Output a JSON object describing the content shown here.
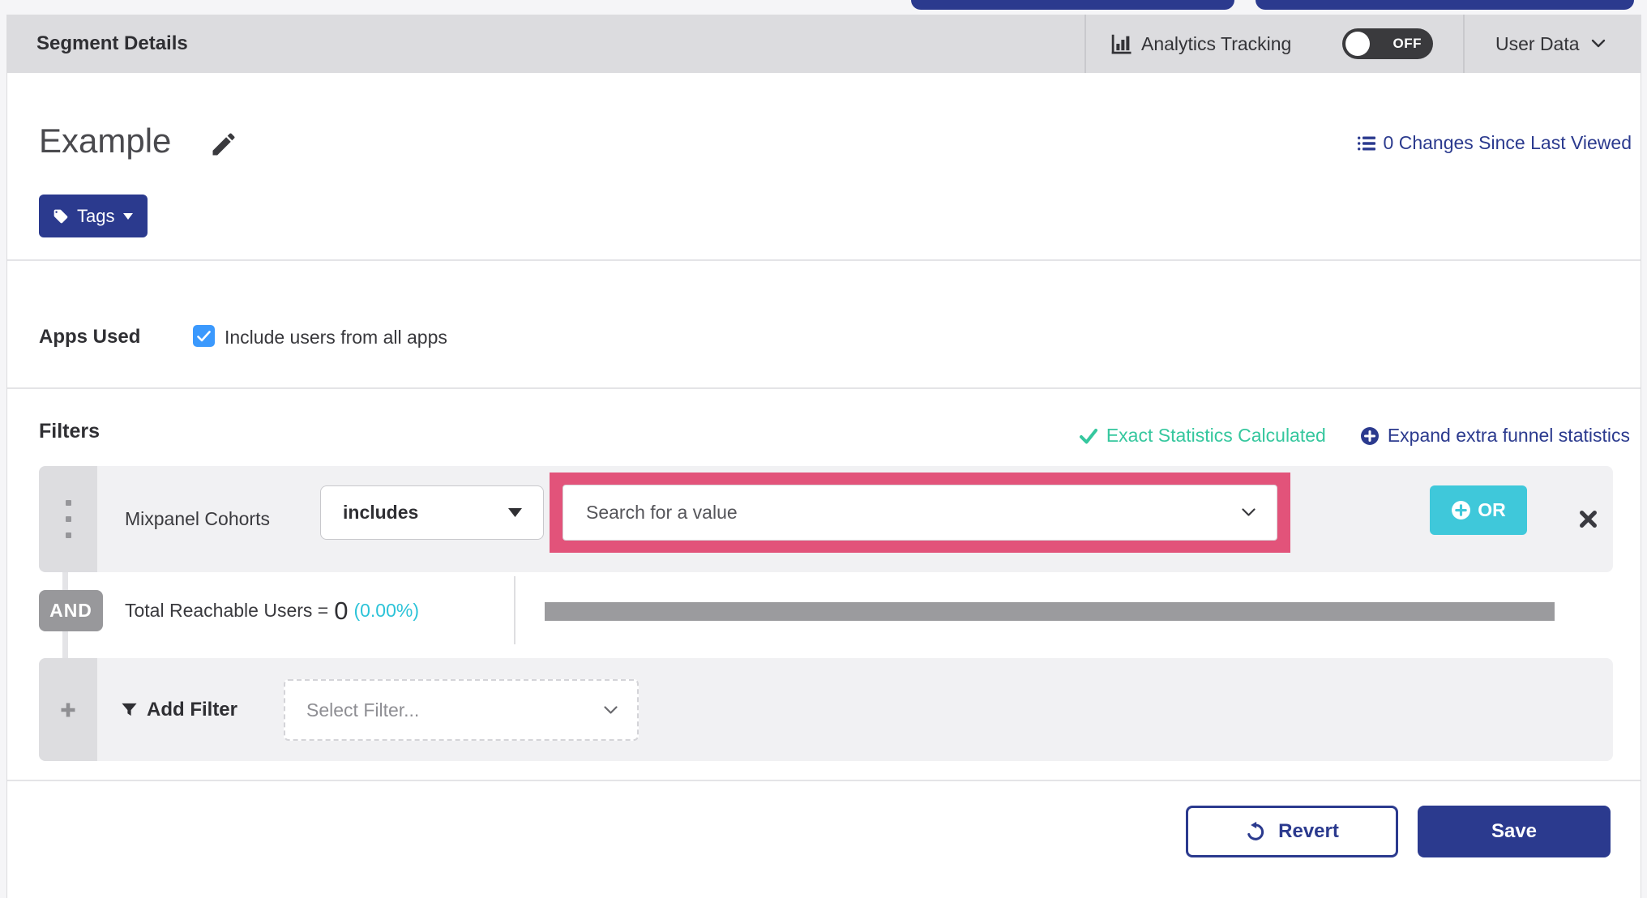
{
  "colors": {
    "indigo": "#2b3a8e",
    "cyan_button": "#3fc8da",
    "cyan_text": "#2cc3d8",
    "green_success": "#35c79e",
    "pink_highlight": "#e2537a",
    "header_bg": "#dcdcdf",
    "row_bg": "#f1f1f3",
    "checkbox_blue": "#3b99fd",
    "badge_gray": "#98989b",
    "bar_gray": "#9b9b9e",
    "toggle_bg": "#3a3a3d"
  },
  "header": {
    "title": "Segment Details",
    "analytics_label": "Analytics Tracking",
    "toggle_state": "OFF",
    "user_data_label": "User Data"
  },
  "segment": {
    "name": "Example",
    "tags_label": "Tags",
    "changes_link": "0 Changes Since Last Viewed"
  },
  "apps": {
    "label": "Apps Used",
    "checkbox_label": "Include users from all apps",
    "checked": true
  },
  "filters": {
    "heading": "Filters",
    "exact_stats": "Exact Statistics Calculated",
    "expand_stats": "Expand extra funnel statistics",
    "row": {
      "field": "Mixpanel Cohorts",
      "operator": "includes",
      "value_placeholder": "Search for a value",
      "or_label": "OR"
    },
    "and_label": "AND",
    "reachable": {
      "label": "Total Reachable Users =",
      "value": "0",
      "percent": "(0.00%)"
    },
    "add": {
      "label": "Add Filter",
      "placeholder": "Select Filter..."
    }
  },
  "footer": {
    "revert": "Revert",
    "save": "Save"
  }
}
